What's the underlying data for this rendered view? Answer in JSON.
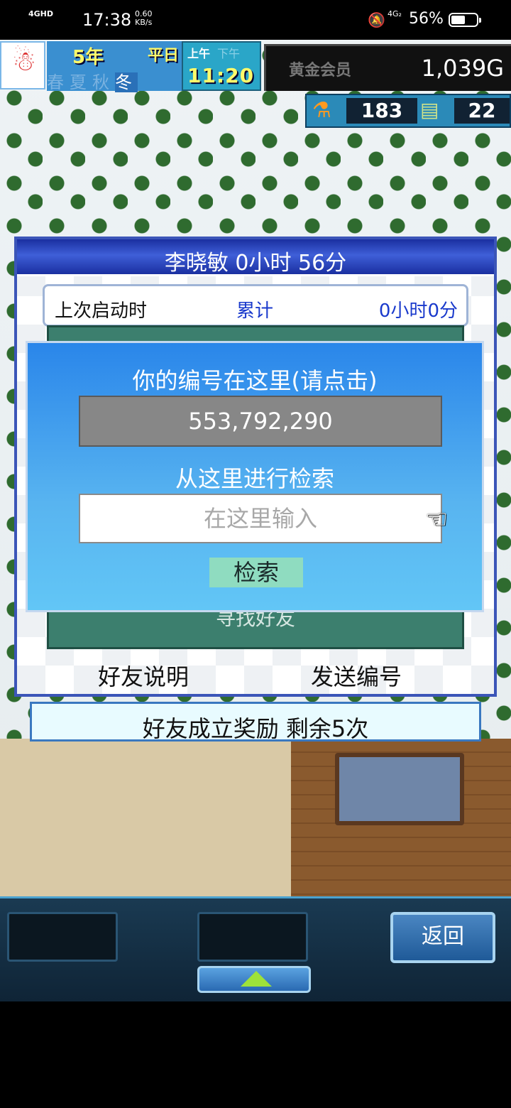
{
  "status_bar": {
    "network": "4GHD",
    "time": "17:38",
    "speed_value": "0.60",
    "speed_unit": "KB/s",
    "sim": "4G₂",
    "battery": "56%",
    "battery_level": 0.56
  },
  "hud": {
    "year": "5年",
    "day_type": "平日",
    "seasons": [
      "春",
      "夏",
      "秋"
    ],
    "current_season": "冬",
    "am": "上午",
    "pm": "下午",
    "clock": "11:20",
    "membership": "黄金会员",
    "gold": "1,039G",
    "research_points": "183",
    "tickets": "22",
    "icons": [
      "snowman-avatar-icon",
      "flask-icon",
      "ticket-icon"
    ]
  },
  "friend_window": {
    "title": "李晓敏  0小时 56分",
    "last_launch_label": "上次启动时",
    "total_label": "累计",
    "total_value": "0小时0分",
    "find_friends": "寻找好友",
    "friend_help": "好友说明",
    "send_id": "发送编号",
    "reward": "好友成立奖励  剩余5次"
  },
  "search_dialog": {
    "prompt_id": "你的编号在这里(请点击)",
    "my_id": "553,792,290",
    "prompt_search": "从这里进行检索",
    "input_placeholder": "在这里输入",
    "input_value": "",
    "search_button": "检索",
    "pointer_icon": "hand-pointer-icon"
  },
  "bottom_bar": {
    "back_button": "返回",
    "expand_icon": "up-arrow-icon"
  }
}
